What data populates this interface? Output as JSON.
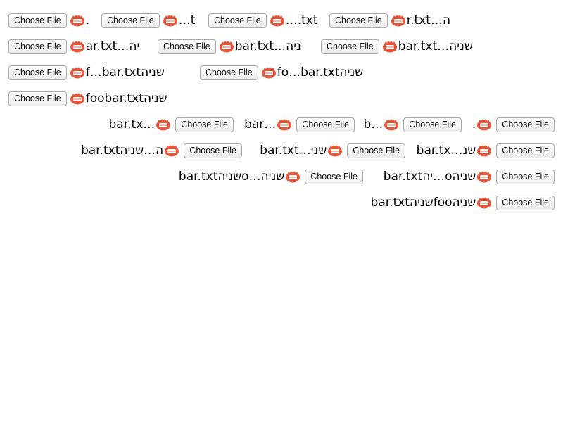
{
  "button_label": "Choose File",
  "icon": "file-emoji-icon",
  "colors": {
    "icon_fill": "#e8563a",
    "icon_inner": "#ffffff",
    "icon_teeth": "#f0a08a"
  },
  "inputs": [
    {
      "direction": "ltr",
      "filename": "."
    },
    {
      "direction": "ltr",
      "filename": "…t"
    },
    {
      "direction": "ltr",
      "filename": "….txt"
    },
    {
      "direction": "ltr",
      "filename": "ה…r.txt"
    },
    {
      "direction": "ltr",
      "filename": "יה…ar.txt"
    },
    {
      "direction": "ltr",
      "filename": "ניה…bar.txt"
    },
    {
      "direction": "ltr",
      "filename": "שניה…bar.txt"
    },
    {
      "direction": "ltr",
      "filename": "שניהf…bar.txt"
    },
    {
      "direction": "ltr",
      "filename": "שניהfo…bar.txt"
    },
    {
      "direction": "ltr",
      "filename": "שניהfoobar.txt"
    },
    {
      "direction": "rtl",
      "filename": "bar.tx…"
    },
    {
      "direction": "rtl",
      "filename": "bar…"
    },
    {
      "direction": "rtl",
      "filename": "b…"
    },
    {
      "direction": "rtl",
      "filename": "."
    },
    {
      "direction": "rtl",
      "filename": "bar.txtה…שניה"
    },
    {
      "direction": "rtl",
      "filename": "bar.txt…שני"
    },
    {
      "direction": "rtl",
      "filename": "bar.tx…שנ"
    },
    {
      "direction": "rtl",
      "filename": "bar.txtשניהo…שניה"
    },
    {
      "direction": "rtl",
      "filename": "bar.txtיה…oשניה"
    },
    {
      "direction": "rtl",
      "filename": "bar.txtשניהfooשניה"
    }
  ]
}
